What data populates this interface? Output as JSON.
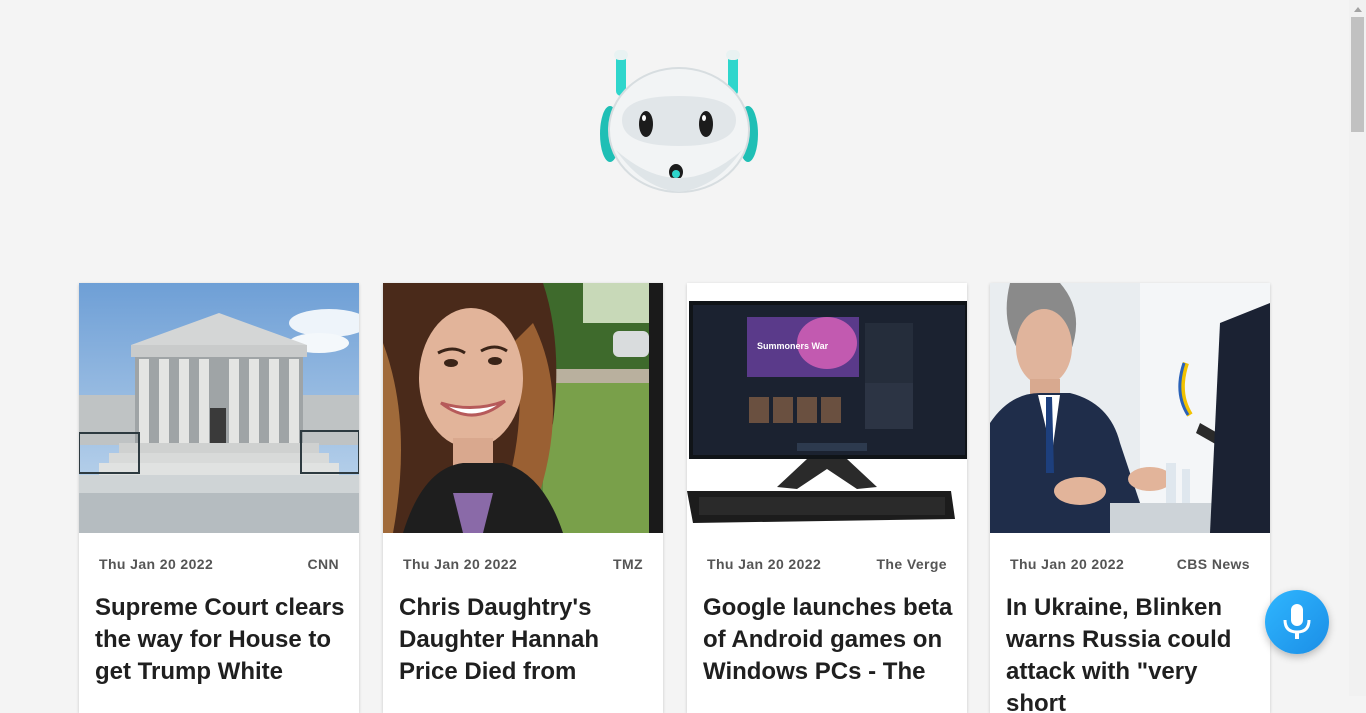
{
  "logo": {
    "icon": "robot-mascot-icon"
  },
  "articles": [
    {
      "date": "Thu Jan 20 2022",
      "source": "CNN",
      "headline": "Supreme Court clears the way for House to get Trump White",
      "image": "supreme-court-building"
    },
    {
      "date": "Thu Jan 20 2022",
      "source": "TMZ",
      "headline": "Chris Daughtry's Daughter Hannah Price Died from",
      "image": "woman-selfie"
    },
    {
      "date": "Thu Jan 20 2022",
      "source": "The Verge",
      "headline": "Google launches beta of Android games on Windows PCs - The",
      "image": "desktop-pc-summoners-war"
    },
    {
      "date": "Thu Jan 20 2022",
      "source": "CBS News",
      "headline": "In Ukraine, Blinken warns Russia could attack with \"very short",
      "image": "man-speaking-at-podium"
    }
  ],
  "image_text": {
    "game_title": "Summoners War"
  },
  "mic_button": {
    "icon": "microphone-icon"
  },
  "colors": {
    "background": "#f4f4f4",
    "accent": "#1ea6f5",
    "logo_teal": "#2fd6cc"
  }
}
